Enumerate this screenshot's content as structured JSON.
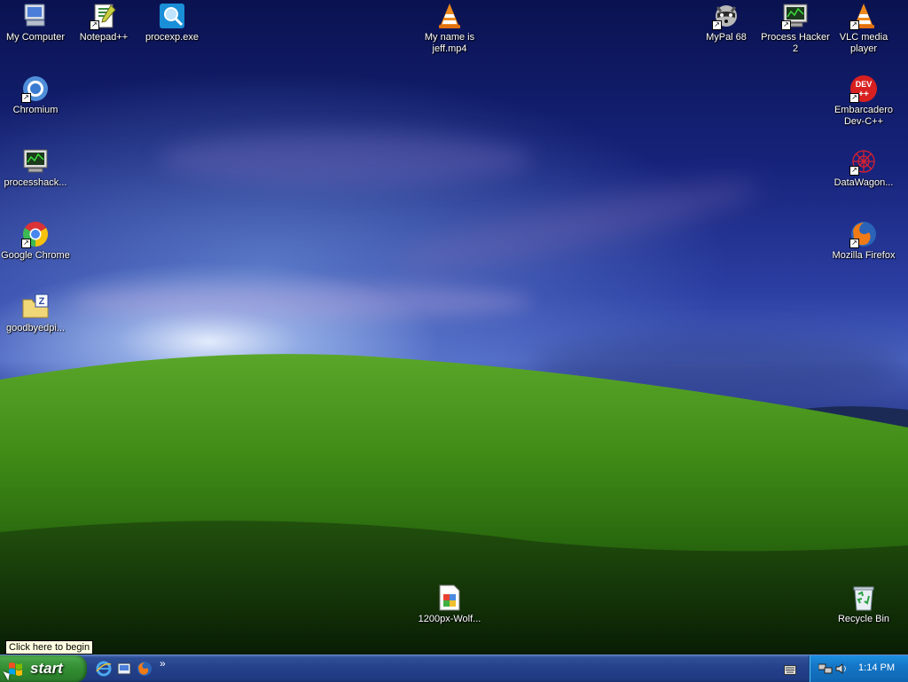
{
  "desktop_icons": {
    "my_computer": "My Computer",
    "notepadpp": "Notepad++",
    "procexp": "procexp.exe",
    "my_name_is_jeff": "My name is jeff.mp4",
    "mypal": "MyPal 68",
    "process_hacker": "Process Hacker 2",
    "vlc": "VLC media player",
    "chromium": "Chromium",
    "embarcadero": "Embarcadero Dev-C++",
    "processhacker_short": "processhack...",
    "datawagon": "DataWagon...",
    "google_chrome": "Google Chrome",
    "mozilla_firefox": "Mozilla Firefox",
    "goodbyedpi": "goodbyedpi...",
    "wolf_image": "1200px-Wolf...",
    "recycle_bin": "Recycle Bin"
  },
  "tooltip": "Click here to begin",
  "taskbar": {
    "start_label": "start",
    "quick_launch": [
      "internet-explorer-icon",
      "show-desktop-icon",
      "firefox-icon"
    ],
    "overflow": "»",
    "clock": "1:14 PM"
  }
}
